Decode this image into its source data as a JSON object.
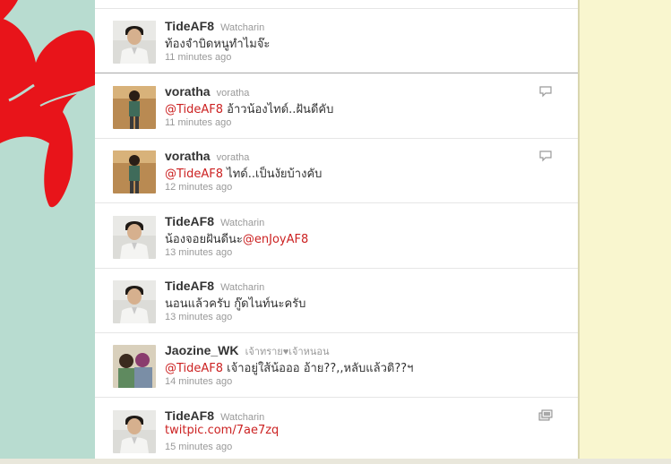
{
  "tweets": [
    {
      "screen_name": "TideAF8",
      "full_name": "Watcharin",
      "text_parts": [
        {
          "t": "ท้องจำบิดหนูทำไมจ๊ะ",
          "link": false
        }
      ],
      "time": "11 minutes ago",
      "avatar": "person-white-shirt",
      "action": "none"
    },
    {
      "screen_name": "voratha",
      "full_name": "voratha",
      "text_parts": [
        {
          "t": "@TideAF8",
          "link": true
        },
        {
          "t": " อ้าวน้องไทด์..ฝันดีคับ",
          "link": false
        }
      ],
      "time": "11 minutes ago",
      "avatar": "person-standing",
      "action": "reply-bubble"
    },
    {
      "screen_name": "voratha",
      "full_name": "voratha",
      "text_parts": [
        {
          "t": "@TideAF8",
          "link": true
        },
        {
          "t": " ไทด์..เป็นงัยบ้างคับ",
          "link": false
        }
      ],
      "time": "12 minutes ago",
      "avatar": "person-standing",
      "action": "reply-bubble"
    },
    {
      "screen_name": "TideAF8",
      "full_name": "Watcharin",
      "text_parts": [
        {
          "t": "น้องจอยฝันดีนะ",
          "link": false
        },
        {
          "t": "@enJoyAF8",
          "link": true
        }
      ],
      "time": "13 minutes ago",
      "avatar": "person-white-shirt",
      "action": "none"
    },
    {
      "screen_name": "TideAF8",
      "full_name": "Watcharin",
      "text_parts": [
        {
          "t": "นอนแล้วครับ กู๊ดไนท์นะครับ",
          "link": false
        }
      ],
      "time": "13 minutes ago",
      "avatar": "person-white-shirt",
      "action": "none"
    },
    {
      "screen_name": "Jaozine_WK",
      "full_name": "เจ้าทราย♥เจ้าหนอน",
      "text_parts": [
        {
          "t": "@TideAF8",
          "link": true
        },
        {
          "t": " เจ้าอยู่ใส้น้อออ อ้าย??,,หลับแล้วติ??ฯ",
          "link": false
        }
      ],
      "time": "14 minutes ago",
      "avatar": "two-people",
      "action": "none"
    },
    {
      "screen_name": "TideAF8",
      "full_name": "Watcharin",
      "text_parts": [
        {
          "t": "twitpic.com/7ae7zq",
          "link": true
        }
      ],
      "time": "15 minutes ago",
      "avatar": "person-white-shirt",
      "action": "media-gallery"
    }
  ],
  "colors": {
    "link": "#cc2222",
    "background_left": "#b8dcd0",
    "background_right": "#f9f6cf",
    "butterfly": "#e8141a"
  }
}
